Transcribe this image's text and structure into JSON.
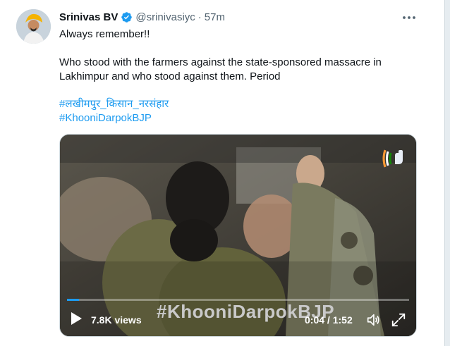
{
  "tweet": {
    "author_name": "Srinivas BV",
    "handle": "@srinivasiyc",
    "separator": "·",
    "time": "57m",
    "line1": "Always remember!!",
    "line2": "Who stood with the farmers against the state-sponsored massacre in",
    "line3": "Lakhimpur and who stood against them. Period",
    "hashtag1": "#लखीमपुर_किसान_नरसंहार",
    "hashtag2": "#KhooniDarpokBJP"
  },
  "video": {
    "overlay_text": "#KhooniDarpokBJP",
    "views": "7.8K views",
    "elapsed": "0:04",
    "time_sep": "/",
    "duration": "1:52",
    "progress_fraction": 0.036
  },
  "colors": {
    "link": "#1d9bf0",
    "verified": "#1d9bf0",
    "muted": "#536471"
  },
  "icons": [
    "verified-badge-icon",
    "more-options-icon",
    "play-icon",
    "volume-icon",
    "fullscreen-icon",
    "congress-logo"
  ]
}
